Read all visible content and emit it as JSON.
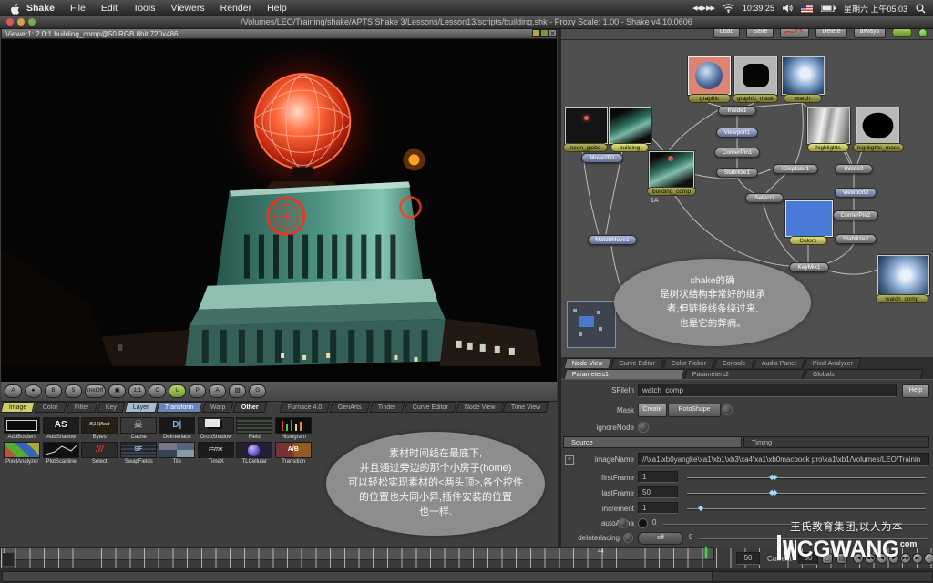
{
  "menubar": {
    "items": [
      "Shake",
      "File",
      "Edit",
      "Tools",
      "Viewers",
      "Render",
      "Help"
    ],
    "media_glyphs": "◀◀ ▶ ▶▶",
    "clock_small": "10:39:25",
    "datetime": "星期六 上午05:03"
  },
  "titlebar": {
    "title": "/Volumes/LEO/Training/shake/APTS Shake 3/Lessons/Lesson13/scripts/building.shk - Proxy Scale: 1.00 - Shake v4.10.0606"
  },
  "viewer": {
    "title": "Viewer1: 2.0:1 building_comp@50 RGB 8bit 720x486",
    "close_glyph": "✕",
    "toolbar": [
      "A",
      "●",
      "B",
      "5",
      "mxOff",
      "▣",
      "1:1",
      "C",
      "U",
      "P",
      "A",
      "▨",
      "G"
    ]
  },
  "tool_tabs": {
    "group1": [
      "Image",
      "Color",
      "Filter",
      "Key",
      "Layer",
      "Transform",
      "Warp",
      "Other"
    ],
    "group2": [
      "Furnace 4.0",
      "GenArts",
      "Tinder",
      "Curve Editor",
      "Node View",
      "Time View"
    ]
  },
  "palette": {
    "items": [
      "AddBorders",
      "AddShadow",
      "Bytes",
      "Cache",
      "DeInterlace",
      "DropShadow",
      "Field",
      "Histogram",
      "PixelAnalyzer",
      "PlotScanline",
      "Select",
      "SwapFields",
      "Tile",
      "TimeX",
      "TLCellular",
      "Transition"
    ],
    "icon_texts": {
      "addshadow": "AS",
      "bytes": "8|16|float",
      "cache": "☠",
      "deinterlace": "D|",
      "select": "///",
      "swapfields": "SF",
      "timex": "t=mx",
      "transition": "A/B"
    }
  },
  "bubble_tools": {
    "lines": [
      "素材时间线在最底下,",
      "并且通过旁边的那个小房子(home)",
      "可以轻松实现素材的<两头顶>,各个控件",
      "的位置也大同小异,插件安装的位置",
      "也一样."
    ]
  },
  "node_view": {
    "buttons": {
      "load": "Load",
      "save": "Save",
      "delete": "Delete",
      "always": "always"
    },
    "bubble": [
      "shake的确",
      "是树状结构非常好的继承",
      "者,但链接线条绕过来,",
      "也是它的弊病。"
    ],
    "nodes": {
      "graphic": "graphic",
      "graphic_mask": "graphic_mask",
      "watch": "watch",
      "neon_globe": "neon_globe",
      "building": "building",
      "building_comp": "building_comp",
      "tag": "1A",
      "highlights": "highlights",
      "highlights_mask": "highlights_mask",
      "color1": "Color1",
      "watch_comp": "watch_comp"
    },
    "pills": {
      "move2d": "Move2D1",
      "matchmove": "MatchMove1",
      "inside1": "Inside1",
      "viewport1": "Viewport1",
      "cornerpin1": "CornerPin1",
      "stabilize1": "Stabilize1",
      "idisplace1": "IDisplace1",
      "select1": "Select1",
      "inside2": "Inside2",
      "viewport2": "Viewport2",
      "cornerpin2": "CornerPin2",
      "stabilize2": "Stabilize2",
      "keymix1": "KeyMix1"
    }
  },
  "tabs": {
    "row1": [
      "Node View",
      "Curve Editor",
      "Color Picker",
      "Console",
      "Audio Panel",
      "Pixel Analyzer"
    ],
    "row2": [
      "Parameters1",
      "Parameters2",
      "Globals"
    ]
  },
  "params": {
    "sfilein_label": "SFileIn",
    "sfilein_value": "watch_comp",
    "help": "Help",
    "mask_label": "Mask",
    "create": "Create",
    "rotoshape": "RotoShape",
    "ignorenode": "ignoreNode",
    "tab_source": "Source",
    "tab_timing": "Timing",
    "imagename_label": "imageName",
    "imagename_value": "//\\xa1\\xb0yangke\\xa1\\xb1\\xb3\\xa4\\xa1\\xb0macbook pro\\xa1\\xb1/Volumes/LEO/Trainin",
    "firstframe_label": "firstFrame",
    "firstframe_value": "1",
    "lastframe_label": "lastFrame",
    "lastframe_value": "50",
    "increment_label": "increment",
    "increment_value": "1",
    "autoalpha_label": "autoAlpha",
    "autoalpha_value": "0",
    "deinterlacing_label": "deInterlacing",
    "deinterlacing_mode": "off",
    "deinterlacing_value": "0"
  },
  "timeline": {
    "start_tick": "1",
    "end_tick": "44",
    "out_value": "50",
    "current_label": "Current",
    "current_value": "50",
    "home_glyph": "⌂",
    "menu_glyph": "▤"
  },
  "transport": [
    "|◀",
    "◀◀",
    "◀",
    "▶",
    "▶▶",
    "▶|",
    "↻"
  ],
  "watermark": {
    "line1": "王氏教育集团,以人为本",
    "brand": "CGWANG",
    "tld": "com"
  }
}
